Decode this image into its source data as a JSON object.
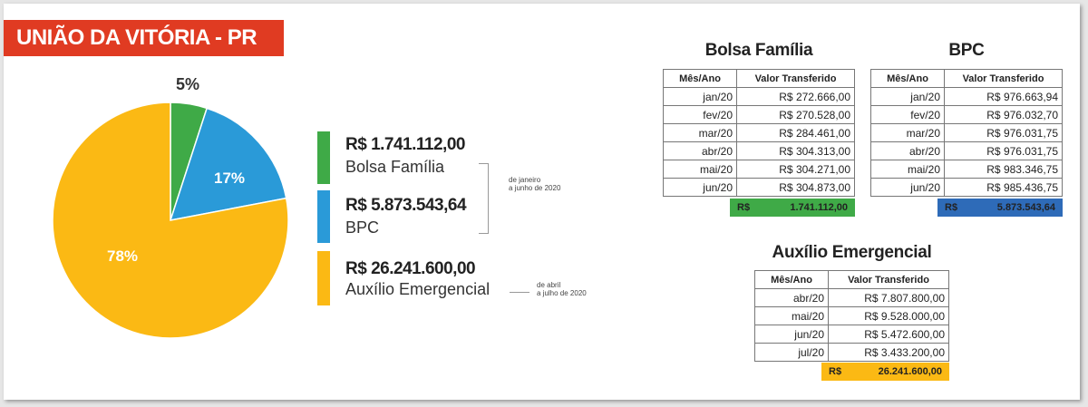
{
  "header": {
    "title": "UNIÃO DA VITÓRIA - PR"
  },
  "colors": {
    "bolsa": "#3faa47",
    "bpc": "#2a9ad8",
    "auxilio": "#fbb914",
    "banner": "#e03b22",
    "bpc_total": "#2e6bb8"
  },
  "chart_data": {
    "type": "pie",
    "slices": [
      {
        "name": "Bolsa Família",
        "value": 5,
        "label": "5%",
        "color": "#3faa47"
      },
      {
        "name": "BPC",
        "value": 17,
        "label": "17%",
        "color": "#2a9ad8"
      },
      {
        "name": "Auxílio Emergencial",
        "value": 78,
        "label": "78%",
        "color": "#fbb914"
      }
    ]
  },
  "legend": {
    "items": [
      {
        "value": "R$ 1.741.112,00",
        "name": "Bolsa Família"
      },
      {
        "value": "R$ 5.873.543,64",
        "name": "BPC"
      },
      {
        "value": "R$ 26.241.600,00",
        "name": "Auxílio Emergencial"
      }
    ],
    "note1": [
      "de janeiro",
      "a junho de 2020"
    ],
    "note2": [
      "de abril",
      "a julho de 2020"
    ]
  },
  "tables": {
    "bolsa": {
      "title": "Bolsa Família",
      "headers": [
        "Mês/Ano",
        "Valor Transferido"
      ],
      "rows": [
        [
          "jan/20",
          "R$ 272.666,00"
        ],
        [
          "fev/20",
          "R$ 270.528,00"
        ],
        [
          "mar/20",
          "R$ 284.461,00"
        ],
        [
          "abr/20",
          "R$ 304.313,00"
        ],
        [
          "mai/20",
          "R$ 304.271,00"
        ],
        [
          "jun/20",
          "R$ 304.873,00"
        ]
      ],
      "total_currency": "R$",
      "total_value": "1.741.112,00"
    },
    "bpc": {
      "title": "BPC",
      "headers": [
        "Mês/Ano",
        "Valor Transferido"
      ],
      "rows": [
        [
          "jan/20",
          "R$ 976.663,94"
        ],
        [
          "fev/20",
          "R$ 976.032,70"
        ],
        [
          "mar/20",
          "R$ 976.031,75"
        ],
        [
          "abr/20",
          "R$ 976.031,75"
        ],
        [
          "mai/20",
          "R$ 983.346,75"
        ],
        [
          "jun/20",
          "R$ 985.436,75"
        ]
      ],
      "total_currency": "R$",
      "total_value": "5.873.543,64"
    },
    "auxilio": {
      "title": "Auxílio Emergencial",
      "headers": [
        "Mês/Ano",
        "Valor Transferido"
      ],
      "rows": [
        [
          "abr/20",
          "R$ 7.807.800,00"
        ],
        [
          "mai/20",
          "R$ 9.528.000,00"
        ],
        [
          "jun/20",
          "R$ 5.472.600,00"
        ],
        [
          "jul/20",
          "R$ 3.433.200,00"
        ]
      ],
      "total_currency": "R$",
      "total_value": "26.241.600,00"
    }
  }
}
